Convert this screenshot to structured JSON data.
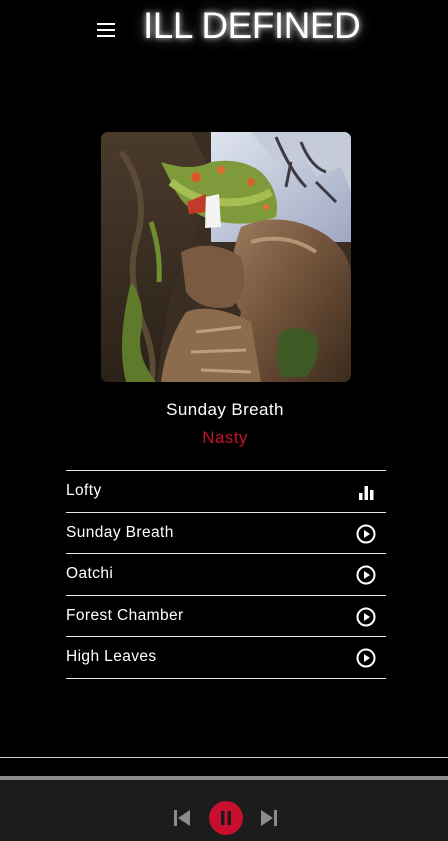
{
  "app": {
    "title": "ILL DEFINED",
    "menu_icon": "hamburger-menu-icon"
  },
  "now_playing": {
    "title": "Sunday Breath",
    "artist": "Nasty",
    "artwork_icon": "album-artwork-image"
  },
  "tracks": [
    {
      "label": "Lofty",
      "icon": "equalizer-bars-icon",
      "playing": true
    },
    {
      "label": "Sunday Breath",
      "icon": "play-circle-icon",
      "playing": false
    },
    {
      "label": "Oatchi",
      "icon": "play-circle-icon",
      "playing": false
    },
    {
      "label": "Forest Chamber",
      "icon": "play-circle-icon",
      "playing": false
    },
    {
      "label": "High Leaves",
      "icon": "play-circle-icon",
      "playing": false
    }
  ],
  "player": {
    "progress": 1.0,
    "prev_icon": "skip-previous-icon",
    "pause_icon": "pause-icon",
    "next_icon": "skip-next-icon"
  },
  "colors": {
    "background": "#000000",
    "accent": "#c8102e",
    "text": "#ffffff",
    "player_bar": "#1c1c1c",
    "control_gray": "#8c8c8c",
    "progress": "#8a8a8a"
  }
}
